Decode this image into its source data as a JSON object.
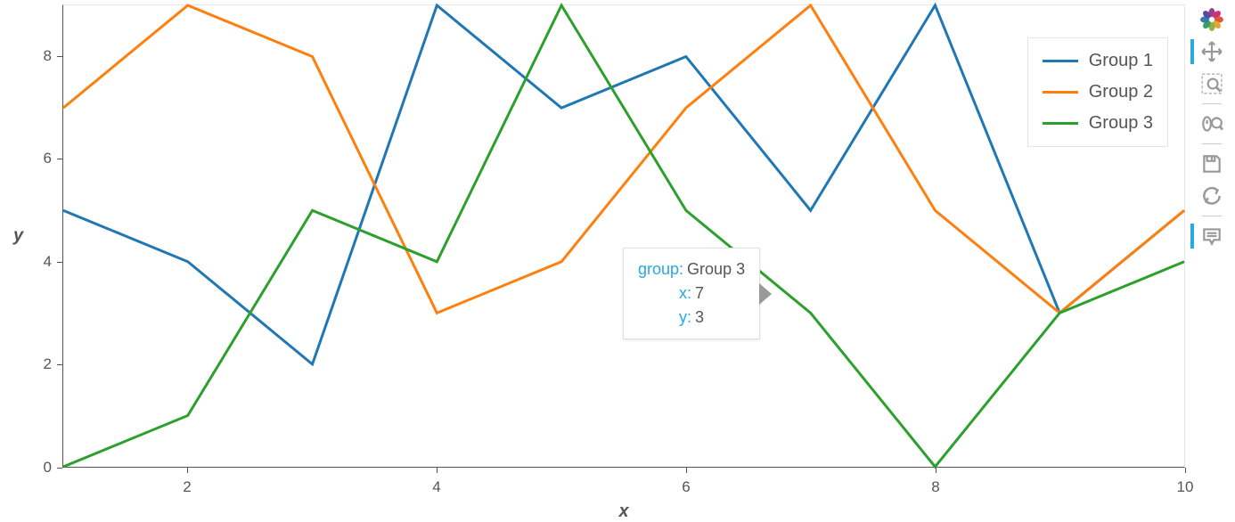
{
  "chart_data": {
    "type": "line",
    "xlabel": "x",
    "ylabel": "y",
    "xlim": [
      1,
      10
    ],
    "ylim": [
      0,
      9
    ],
    "x_ticks": [
      2,
      4,
      6,
      8,
      10
    ],
    "y_ticks": [
      0,
      2,
      4,
      6,
      8
    ],
    "x": [
      1,
      2,
      3,
      4,
      5,
      6,
      7,
      8,
      9,
      10
    ],
    "series": [
      {
        "name": "Group 1",
        "color": "#1f77b4",
        "values": [
          5,
          4,
          2,
          9,
          7,
          8,
          5,
          9,
          3,
          5
        ]
      },
      {
        "name": "Group 2",
        "color": "#ff7f0e",
        "values": [
          7,
          9,
          8,
          3,
          4,
          7,
          9,
          5,
          3,
          5
        ]
      },
      {
        "name": "Group 3",
        "color": "#2ca02c",
        "values": [
          0,
          1,
          5,
          4,
          9,
          5,
          3,
          0,
          3,
          4
        ]
      }
    ],
    "legend_position": "top-right"
  },
  "tooltip": {
    "group_key": "group:",
    "group_val": "Group 3",
    "x_key": "x:",
    "x_val": "7",
    "y_key": "y:",
    "y_val": "3"
  },
  "legend": {
    "items": [
      {
        "label": "Group 1"
      },
      {
        "label": "Group 2"
      },
      {
        "label": "Group 3"
      }
    ]
  },
  "toolbar": {
    "logo": "bokeh",
    "tools": [
      {
        "name": "pan",
        "active": true
      },
      {
        "name": "box-zoom",
        "active": false
      },
      {
        "name": "wheel-zoom",
        "active": false
      },
      {
        "name": "save",
        "active": false
      },
      {
        "name": "reset",
        "active": false
      },
      {
        "name": "hover",
        "active": true
      }
    ]
  }
}
